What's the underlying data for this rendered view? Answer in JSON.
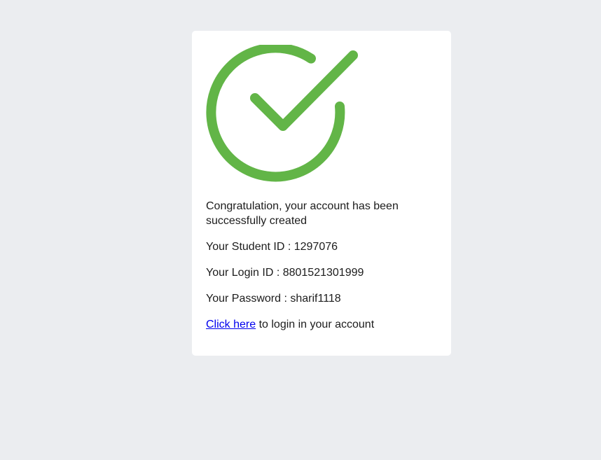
{
  "status": {
    "icon": "success-checkmark-icon",
    "accent_color": "#62b547"
  },
  "message": {
    "congratulation": "Congratulation, your account has been successfully created"
  },
  "details": {
    "student_id_label": "Your Student ID : ",
    "student_id": "1297076",
    "login_id_label": "Your Login ID : ",
    "login_id": "8801521301999",
    "password_label": "Your Password : ",
    "password": "sharif1118"
  },
  "login_prompt": {
    "link_text": "Click here",
    "suffix": " to login in your account"
  }
}
